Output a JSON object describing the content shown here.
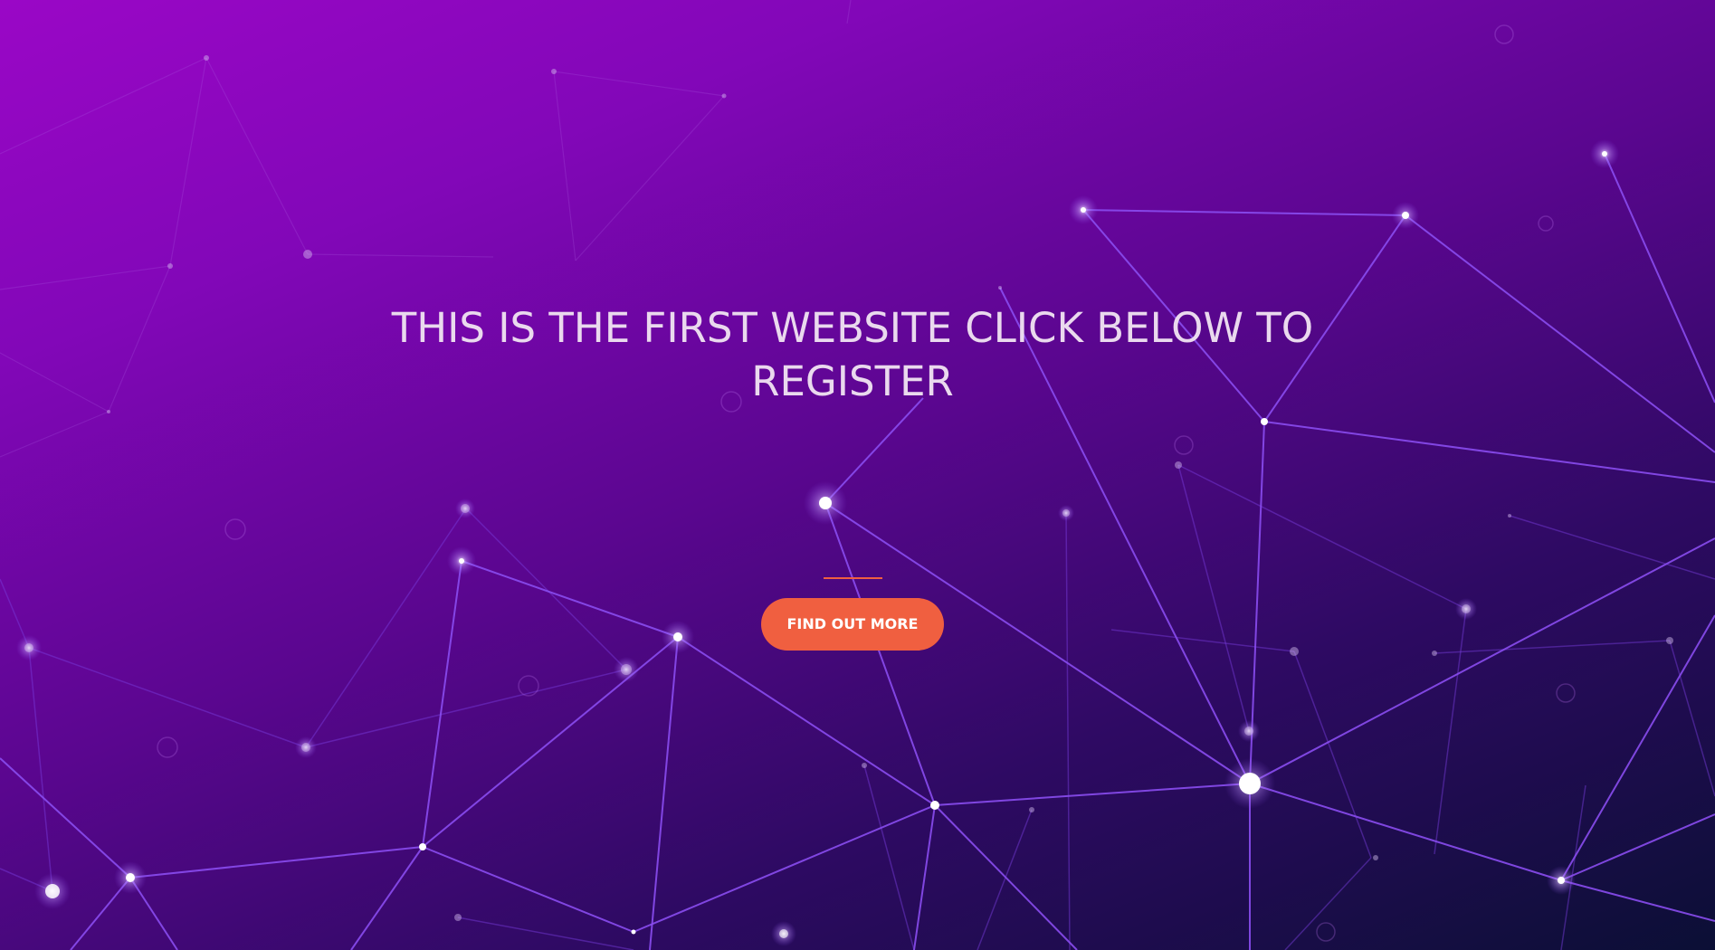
{
  "hero": {
    "headline": "THIS IS THE FIRST WEBSITE CLICK BELOW TO REGISTER",
    "cta_label": "FIND OUT MORE"
  },
  "colors": {
    "accent": "#f05f40",
    "text": "#ead9ee",
    "background_top_left": "#9a07c6",
    "background_bottom_right": "#0b0f35",
    "network_line": "#8a4cf0"
  }
}
